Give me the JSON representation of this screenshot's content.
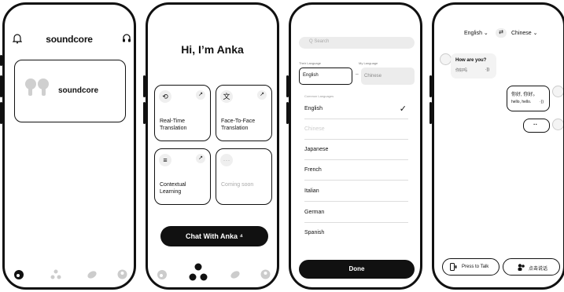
{
  "phone1": {
    "brand": "soundcore",
    "device_card_label": "soundcore"
  },
  "phone2": {
    "greeting": "Hi, I’m Anka",
    "tiles": [
      {
        "label": "Real-Time\nTranslation",
        "icon": "translate-icon"
      },
      {
        "label": "Face-To-Face\nTranslation",
        "icon": "face-translate-icon"
      },
      {
        "label": "Contextual\nLearning",
        "icon": "learning-icon"
      },
      {
        "label": "Coming soon",
        "icon": "more-dots-icon"
      }
    ],
    "chat_button": "Chat With Anka ⁴"
  },
  "phone3": {
    "search_placeholder": "Q Search",
    "their_language_label": "Their Language",
    "my_language_label": "My Language",
    "their_language": "English",
    "swap_symbol": "⇔",
    "my_language": "Chinese",
    "common_languages_label": "Common Languages",
    "languages": [
      "English",
      "Chinese",
      "Japanese",
      "French",
      "Italian",
      "German",
      "Spanish"
    ],
    "selected": "English",
    "check": "✓",
    "done": "Done"
  },
  "phone4": {
    "left_lang": "English ⌄",
    "swap": "⇄",
    "right_lang": "Chinese ⌄",
    "messages": [
      {
        "side": "left",
        "title": "How are you?",
        "sub": "你好吗"
      },
      {
        "side": "right",
        "title": "你好, 你好。",
        "sub": "hello, hello."
      },
      {
        "side": "right",
        "title": "··",
        "sub": ""
      }
    ],
    "press_to_talk": "Press to Talk",
    "press_to_talk_cn": "点击说话"
  }
}
